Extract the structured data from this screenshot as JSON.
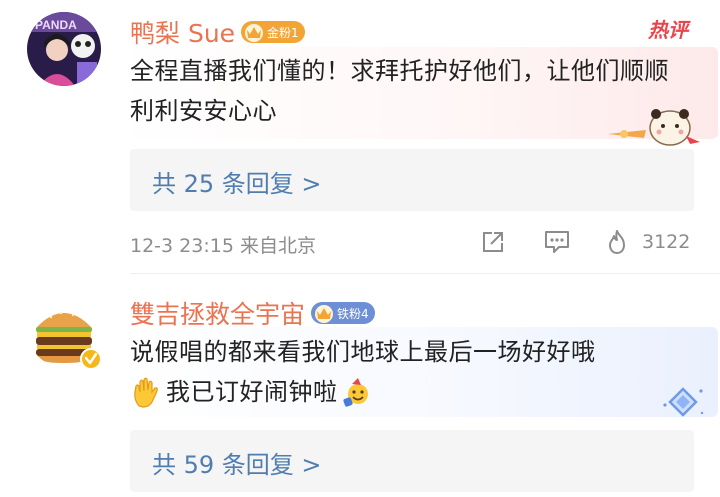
{
  "comments": [
    {
      "username": "鸭梨 Sue",
      "fan_badge": "金粉1",
      "hot_tag": "热评",
      "text": "全程直播我们懂的！求拜托护好他们，让他们顺顺利利安安心心",
      "replies": "共 25 条回复 >",
      "timestamp": "12-3 23:15 来自北京",
      "likes": "3122"
    },
    {
      "username": "雙吉拯救全宇宙",
      "fan_badge": "铁粉4",
      "text_line1": "说假唱的都来看我们地球上最后一场好好哦",
      "text_line2": "我已订好闹钟啦",
      "replies": "共 59 条回复 >"
    }
  ],
  "colors": {
    "username": "#eb7350",
    "link": "#507daf",
    "meta": "#8c8c8c",
    "gold_badge": "#f2a535",
    "iron_badge": "#6d8fd6",
    "hot": "#e8464c"
  },
  "icons": [
    "share-icon",
    "comment-icon",
    "like-icon",
    "verified-icon",
    "crown-icon"
  ]
}
